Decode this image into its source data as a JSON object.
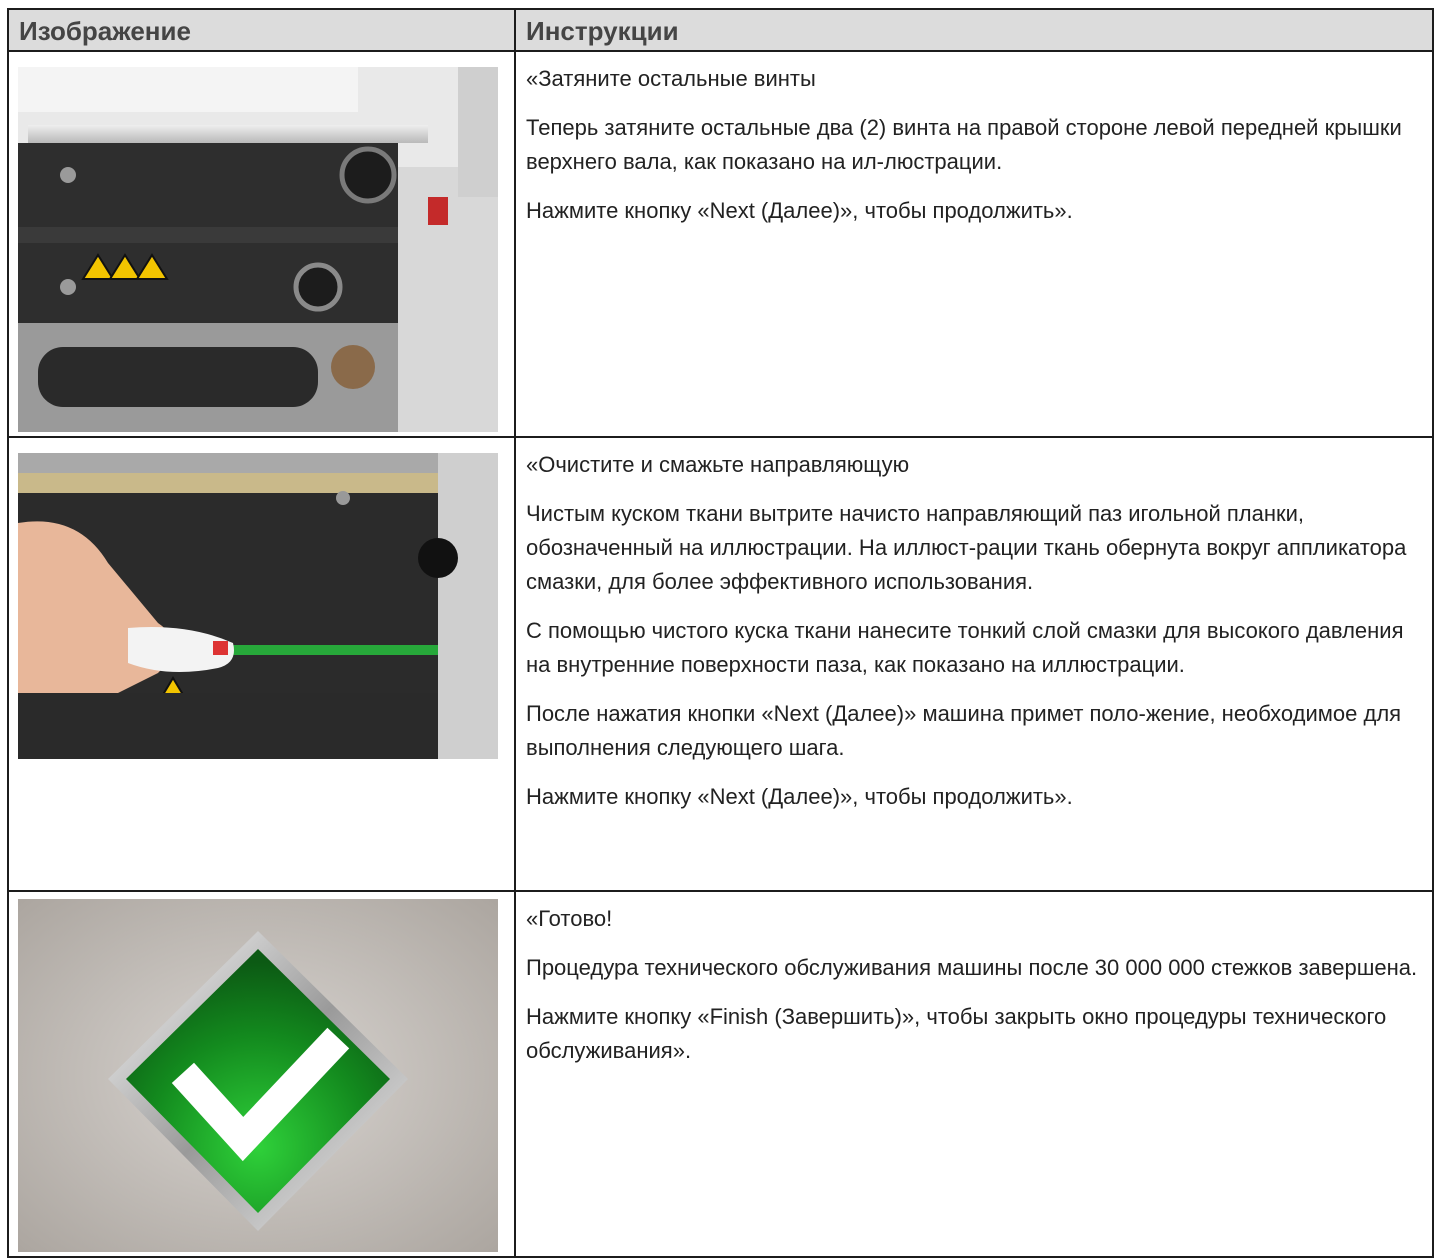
{
  "table": {
    "headers": {
      "image": "Изображение",
      "instructions": "Инструкции"
    },
    "rows": [
      {
        "image_icon": "machine-screws-photo",
        "paragraphs": [
          "«Затяните остальные винты",
          "Теперь затяните остальные два (2) винта на правой стороне левой передней крышки верхнего вала, как показано на ил-люстрации.",
          "Нажмите кнопку «Next (Далее)», чтобы продолжить»."
        ]
      },
      {
        "image_icon": "clean-guide-photo",
        "paragraphs": [
          "«Очистите и смажьте направляющую",
          "Чистым куском ткани вытрите начисто направляющий паз игольной планки, обозначенный на иллюстрации. На иллюст-рации ткань обернута вокруг аппликатора смазки, для более эффективного использования.",
          "С помощью чистого куска ткани нанесите тонкий слой смазки для высокого давления на внутренние поверхности паза, как показано на иллюстрации.",
          "После нажатия кнопки «Next (Далее)» машина примет поло-жение, необходимое для выполнения следующего шага.",
          "Нажмите кнопку «Next (Далее)», чтобы продолжить»."
        ]
      },
      {
        "image_icon": "green-checkmark-icon",
        "paragraphs": [
          "«Готово!",
          "Процедура технического обслуживания машины после 30 000 000 стежков завершена.",
          "Нажмите кнопку «Finish (Завершить)», чтобы закрыть окно процедуры технического обслуживания»."
        ]
      }
    ]
  }
}
